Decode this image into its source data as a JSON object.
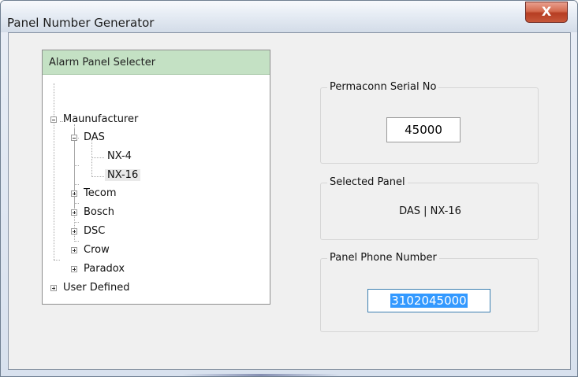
{
  "window": {
    "title": "Panel Number Generator",
    "close_glyph": "X"
  },
  "tree": {
    "header": "Alarm Panel Selecter",
    "nodes": [
      {
        "label": "Maunufacturer",
        "state": "expanded"
      },
      {
        "label": "DAS",
        "state": "expanded"
      },
      {
        "label": "NX-4",
        "state": "leaf"
      },
      {
        "label": "NX-16",
        "state": "leaf-selected"
      },
      {
        "label": "Tecom",
        "state": "collapsed"
      },
      {
        "label": "Bosch",
        "state": "collapsed"
      },
      {
        "label": "DSC",
        "state": "collapsed"
      },
      {
        "label": "Crow",
        "state": "collapsed"
      },
      {
        "label": "Paradox",
        "state": "collapsed"
      },
      {
        "label": "User Defined",
        "state": "collapsed"
      }
    ]
  },
  "serial": {
    "label": "Permaconn Serial No",
    "value": "45000"
  },
  "selected_panel": {
    "label": "Selected Panel",
    "value": "DAS | NX-16"
  },
  "phone": {
    "label": "Panel Phone Number",
    "value": "3102045000"
  },
  "colors": {
    "tree_header_bg": "#c4e1c4",
    "selection_highlight": "#3399ff",
    "close_button": "#c6573a"
  }
}
